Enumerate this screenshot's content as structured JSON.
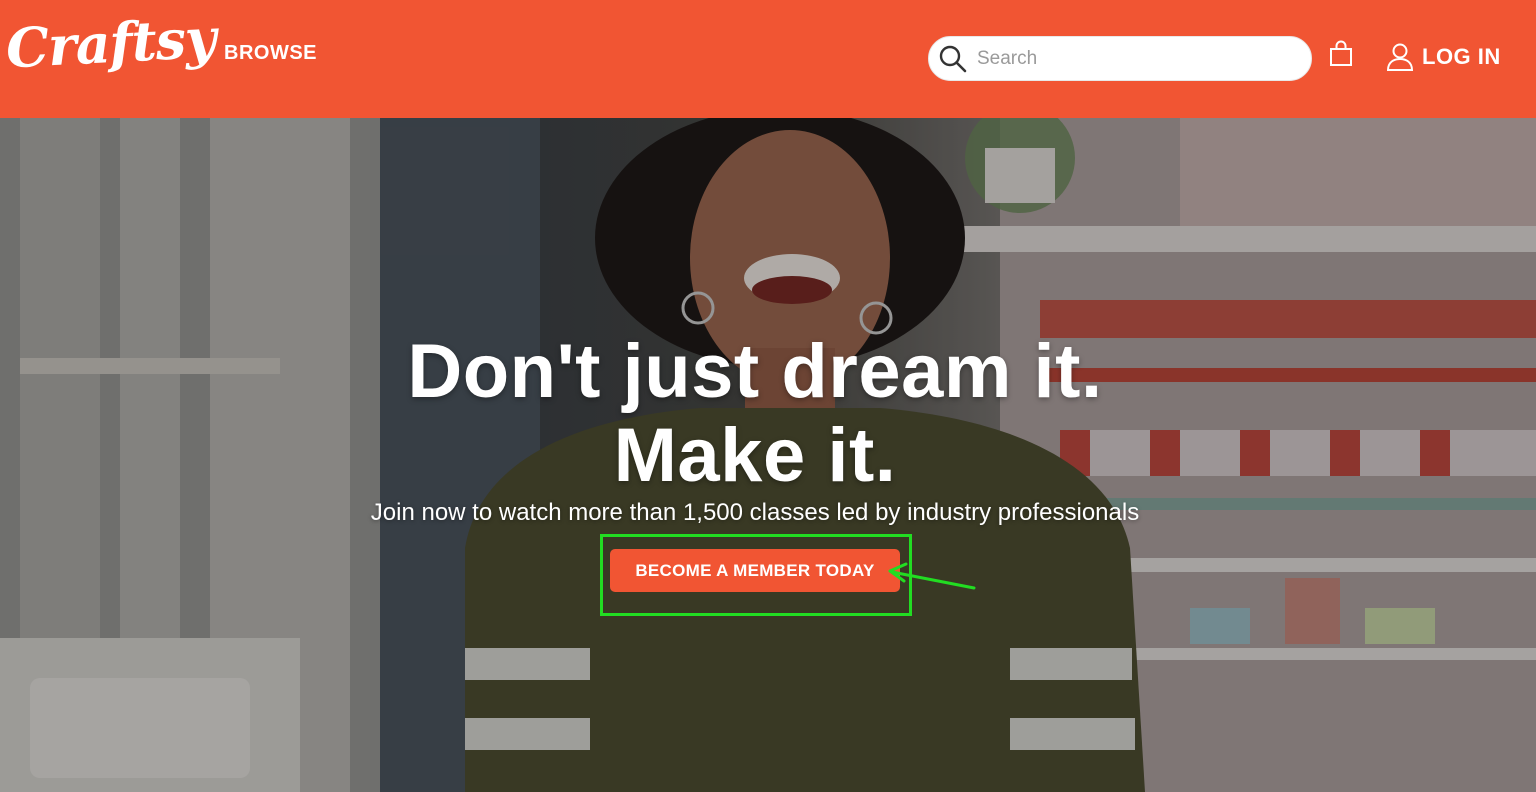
{
  "header": {
    "logo_text": "Craftsy",
    "browse_label": "BROWSE",
    "search": {
      "placeholder": "Search",
      "value": ""
    },
    "login_label": "LOG IN",
    "brand_color": "#f15533"
  },
  "hero": {
    "headline_line1": "Don't just dream it.",
    "headline_line2": "Make it.",
    "subline": "Join now to watch more than 1,500 classes led by industry professionals",
    "cta_label": "BECOME A MEMBER TODAY",
    "cta_color": "#f15533",
    "annotation_color": "#22dd22"
  },
  "icons": [
    "search-icon",
    "shopping-bag-icon",
    "user-icon",
    "arrow-icon"
  ]
}
